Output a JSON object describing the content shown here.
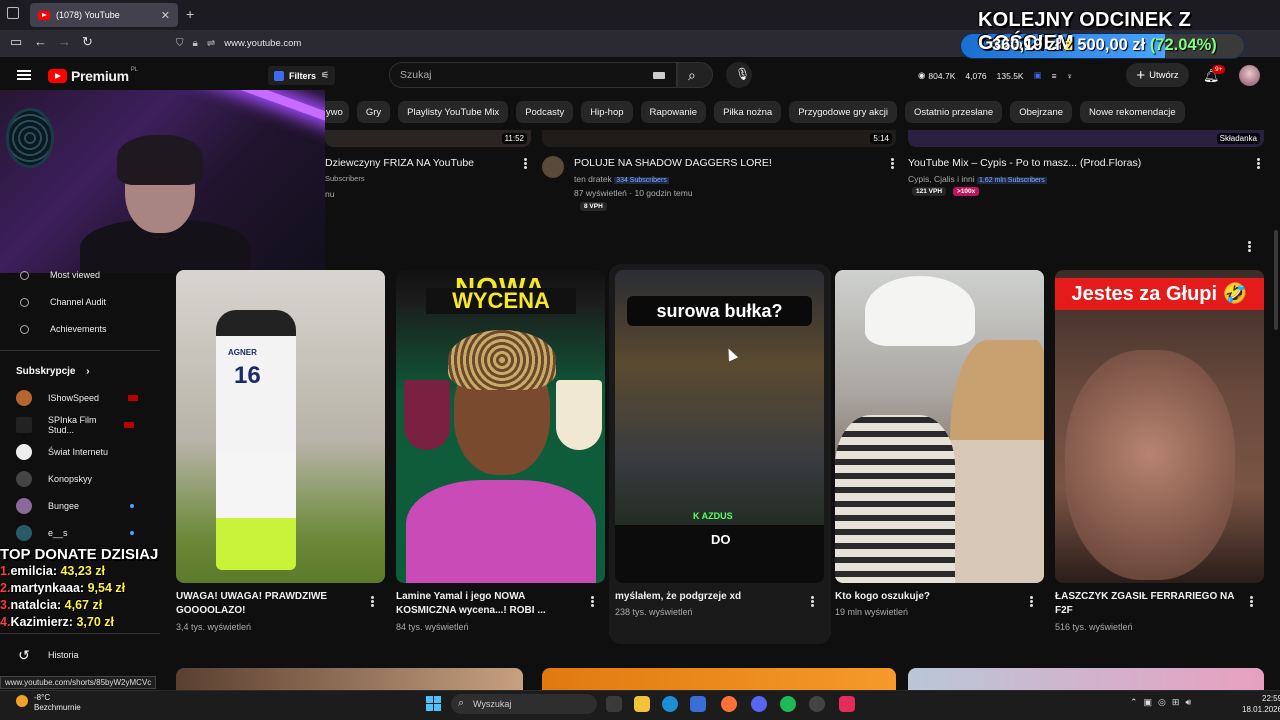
{
  "browser": {
    "tab_title": "(1078) YouTube",
    "url": "www.youtube.com",
    "status_url": "www.youtube.com/shorts/85byW2yMCVc"
  },
  "overlay": {
    "goal_title": "KOLEJNY ODCINEK Z GOŚCIEM",
    "goal_current": "360,19 zł",
    "goal_sep": "z",
    "goal_target": "500,00 zł",
    "goal_percent": "(72.04%)",
    "goal_progress": 0.7204,
    "donate_title": "TOP DONATE DZISIAJ",
    "donates": [
      {
        "rank": "1.",
        "name": "emilcia:",
        "amount": "43,23 zł"
      },
      {
        "rank": "2.",
        "name": "martynkaaa:",
        "amount": "9,54 zł"
      },
      {
        "rank": "3.",
        "name": "natalcia:",
        "amount": "4,67 zł"
      },
      {
        "rank": "4.",
        "name": "Kazimierz:",
        "amount": "3,70 zł"
      }
    ]
  },
  "header": {
    "logo_text": "Premium",
    "logo_region": "PL",
    "filters_label": "Filters",
    "search_placeholder": "Szukaj",
    "stat_views": "804.7K",
    "stat_likes": "4,076",
    "stat_subs": "135.5K",
    "create_label": "Utwórz",
    "notif_badge": "9+"
  },
  "chips": [
    "...ywo",
    "Gry",
    "Playlisty YouTube Mix",
    "Podcasty",
    "Hip-hop",
    "Rapowanie",
    "Piłka nożna",
    "Przygodowe gry akcji",
    "Ostatnio przesłane",
    "Obejrzane",
    "Nowe rekomendacje"
  ],
  "sidebar": {
    "tools": [
      "Most viewed",
      "Channel Audit",
      "Achievements"
    ],
    "subs_header": "Subskrypcje",
    "subscriptions": [
      {
        "name": "IShowSpeed",
        "badge": "live"
      },
      {
        "name": "SPInka Film Stud...",
        "badge": "live"
      },
      {
        "name": "Świat Internetu",
        "badge": ""
      },
      {
        "name": "Konopskyy",
        "badge": ""
      },
      {
        "name": "Bungee",
        "badge": "dot"
      },
      {
        "name": "e__s",
        "badge": "dot"
      }
    ],
    "history": "Historia"
  },
  "top_row": [
    {
      "duration": "11:52",
      "title": "Dziewczyny FRIZA NA YouTube",
      "meta": "Subscribers",
      "meta2": "nu"
    },
    {
      "duration": "5:14",
      "title": "POLUJE NA SHADOW DAGGERS LORE!",
      "channel": "ten dratek",
      "subs": "334 Subscribers",
      "meta": "87 wyświetleń · 10 godzin temu",
      "vph": "8 VPH"
    },
    {
      "duration": "Składanka",
      "title": "YouTube Mix – Cypis - Po to masz... (Prod.Floras)",
      "channel": "Cypis, Cjalis i inni",
      "subs": "1,62 mln Subscribers",
      "vph": "121 VPH",
      "x": ">100x"
    }
  ],
  "shorts": [
    {
      "title": "UWAGA! UWAGA! PRAWDZIWE GOOOOLAZO!",
      "views": "3,4 tys. wyświetleń",
      "jersey": "16",
      "jersey_name": "AGNER"
    },
    {
      "title": "Lamine Yamal i jego NOWA KOSMICZNA wycena...! ROBI ...",
      "views": "84 tys. wyświetleń",
      "thumb_text1": "NOWA",
      "thumb_text2": "WYCENA"
    },
    {
      "title": "myślałem, że podgrzeje xd",
      "views": "238 tys. wyświetleń",
      "thumb_text": "surowa bułka?",
      "thumb_sub": "K AZDUS",
      "thumb_do": "DO"
    },
    {
      "title": "Kto kogo oszukuje?",
      "views": "19 mln wyświetleń"
    },
    {
      "title": "ŁASZCZYK ZGASIŁ FERRARIEGO NA F2F",
      "views": "516 tys. wyświetleń",
      "thumb_text": "Jestes za Głupi 🤣"
    }
  ],
  "taskbar": {
    "temp": "-8°C",
    "weather": "Bezchmurnie",
    "search": "Wyszukaj",
    "time": "22:59",
    "date": "18.01.2026"
  },
  "colors": {
    "accent": "#ff0000",
    "chip_bg": "#272727",
    "bg": "#0f0f0f"
  }
}
